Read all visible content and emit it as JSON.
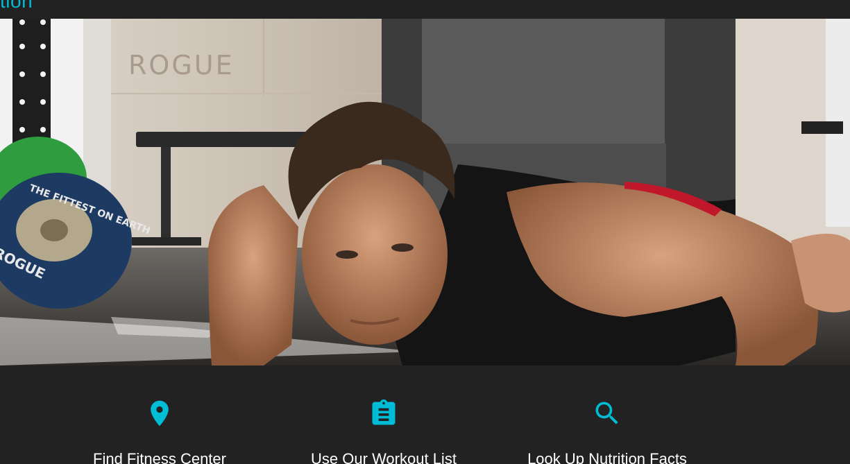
{
  "header": {
    "brand": "tion",
    "nav": [
      "",
      "",
      ""
    ]
  },
  "hero": {
    "plate_text": "THE FITTEST ON EARTH",
    "wall_text": "ROGUE",
    "plate_brand": "ROGUE"
  },
  "features": [
    {
      "icon": "map-pin-icon",
      "title": "Find Fitness Center"
    },
    {
      "icon": "clipboard-list-icon",
      "title": "Use Our Workout List"
    },
    {
      "icon": "search-icon",
      "title": "Look Up Nutrition Facts"
    }
  ],
  "colors": {
    "accent": "#00bcd4",
    "background": "#222222",
    "text": "#ffffff"
  }
}
